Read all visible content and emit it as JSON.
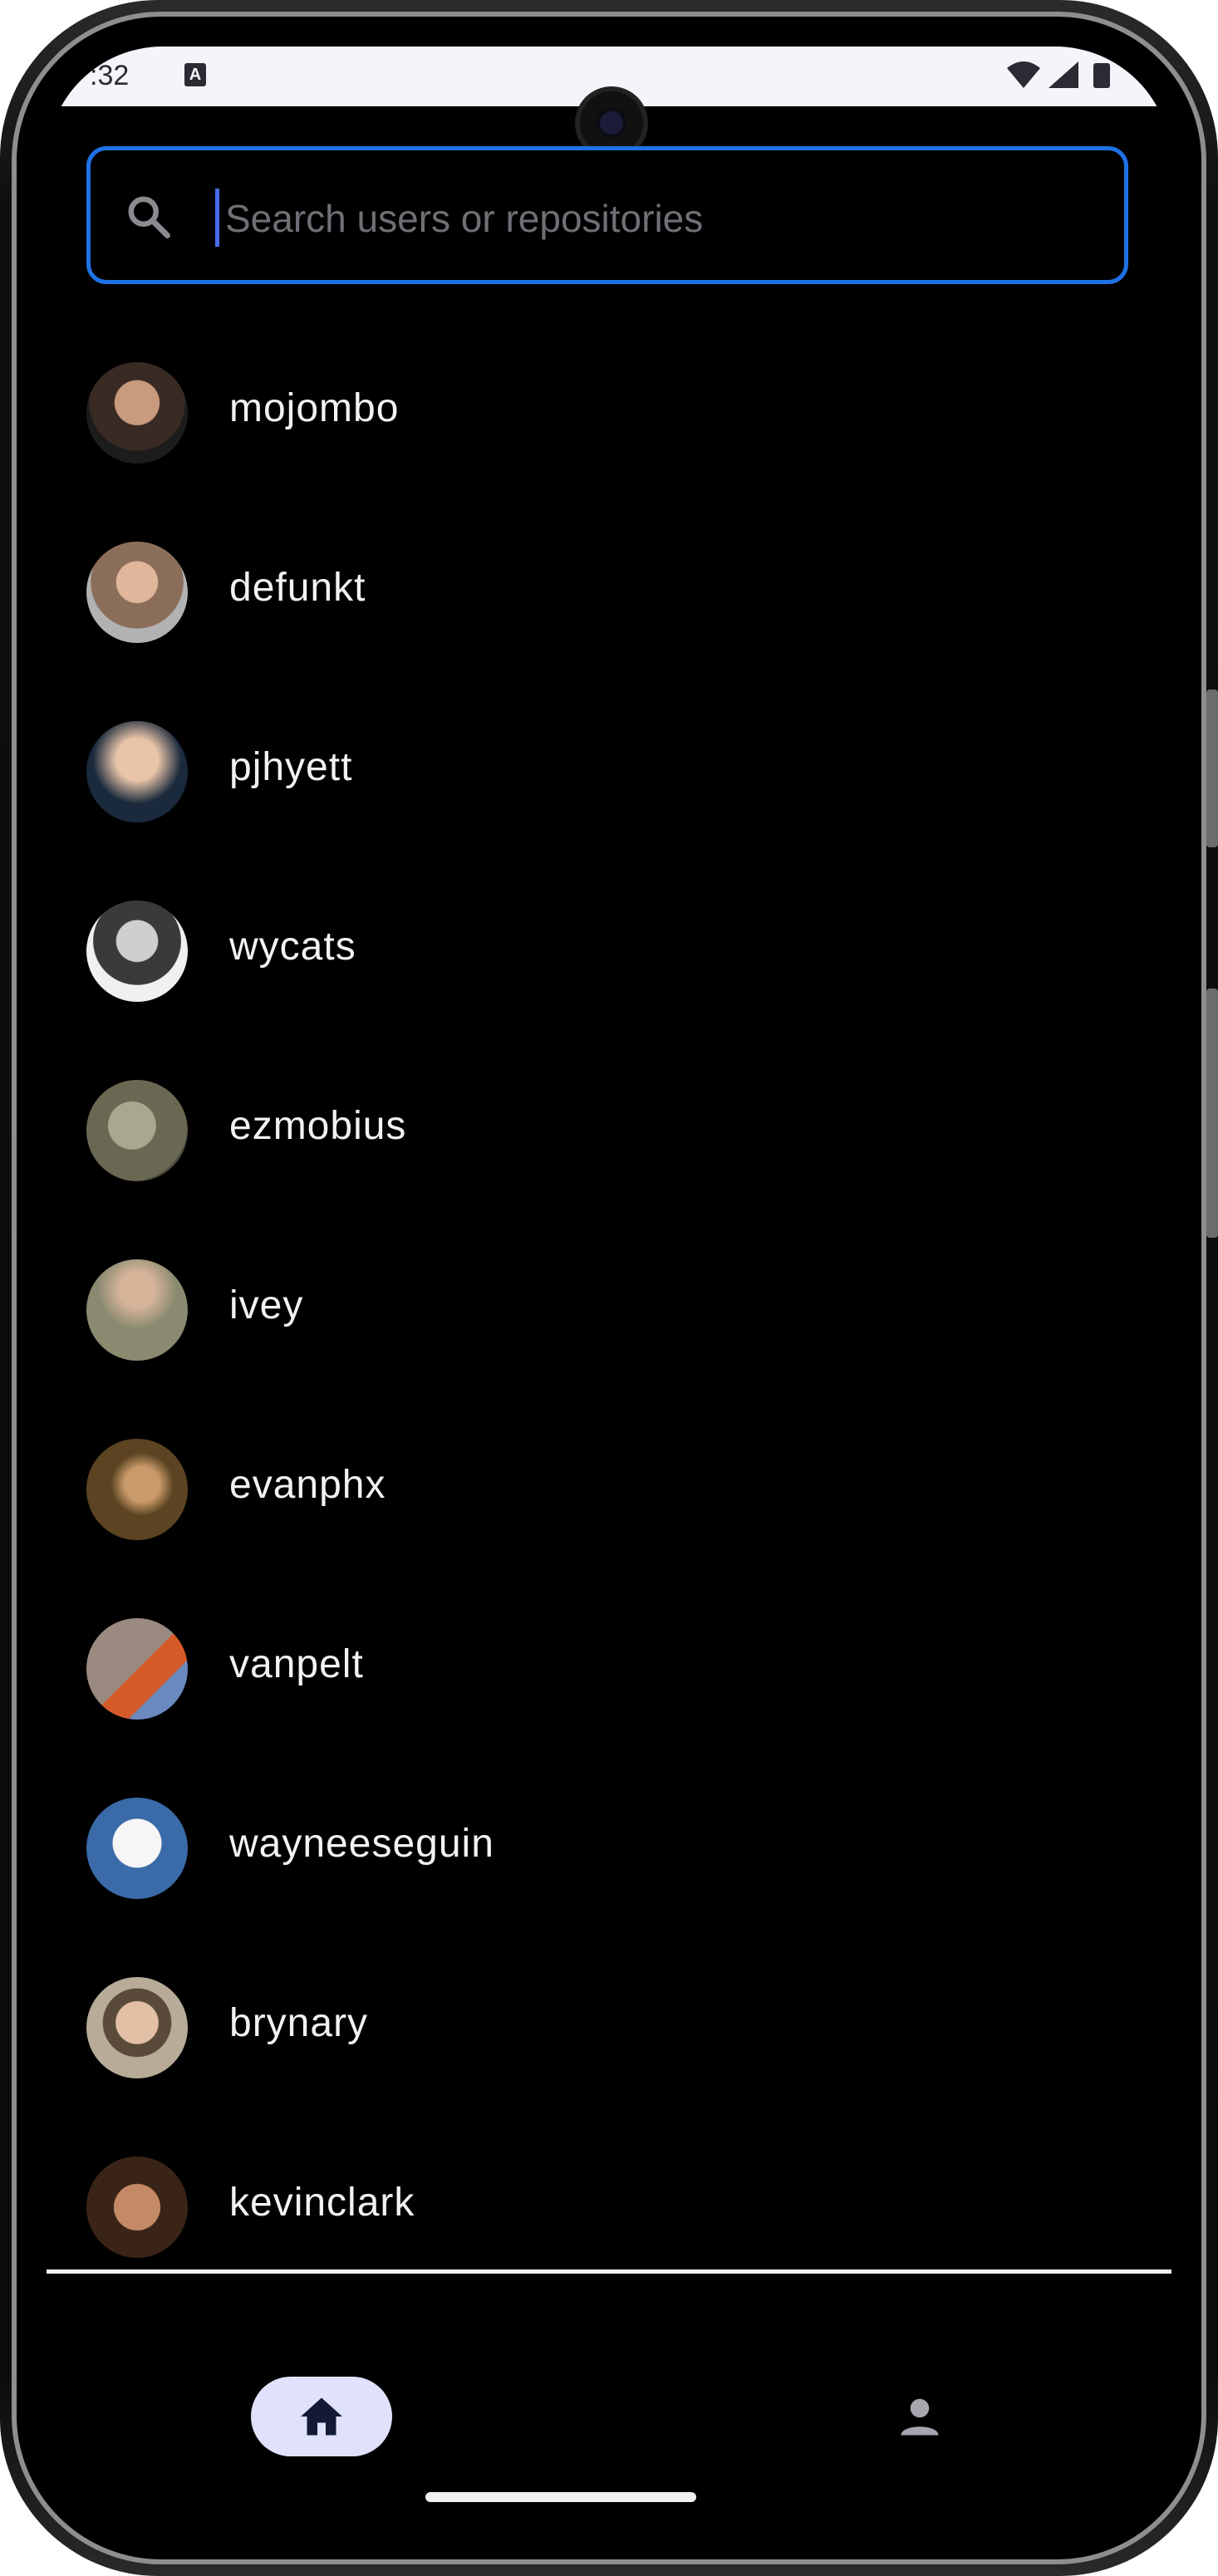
{
  "status_bar": {
    "time": ":32",
    "keyboard_indicator": "A"
  },
  "search": {
    "placeholder": "Search users or repositories",
    "value": ""
  },
  "users": [
    {
      "login": "mojombo",
      "avatar_color": "#3a2a24"
    },
    {
      "login": "defunkt",
      "avatar_color": "#8b6e5a"
    },
    {
      "login": "pjhyett",
      "avatar_color": "#c9c2b6"
    },
    {
      "login": "wycats",
      "avatar_color": "#d8d8d8"
    },
    {
      "login": "ezmobius",
      "avatar_color": "#7c7a62"
    },
    {
      "login": "ivey",
      "avatar_color": "#9a9a82"
    },
    {
      "login": "evanphx",
      "avatar_color": "#5c4422"
    },
    {
      "login": "vanpelt",
      "avatar_color": "#8a6a5a"
    },
    {
      "login": "wayneeseguin",
      "avatar_color": "#3a6aa8"
    },
    {
      "login": "brynary",
      "avatar_color": "#b8ab98"
    },
    {
      "login": "kevinclark",
      "avatar_color": "#3a2418"
    }
  ],
  "bottom_nav": {
    "items": [
      {
        "icon": "home-icon",
        "selected": true
      },
      {
        "icon": "person-icon",
        "selected": false
      }
    ]
  },
  "colors": {
    "accent": "#1f72e6",
    "nav_selected_bg": "#dfe2fa",
    "background": "#000000",
    "text": "#f2f2f2"
  }
}
